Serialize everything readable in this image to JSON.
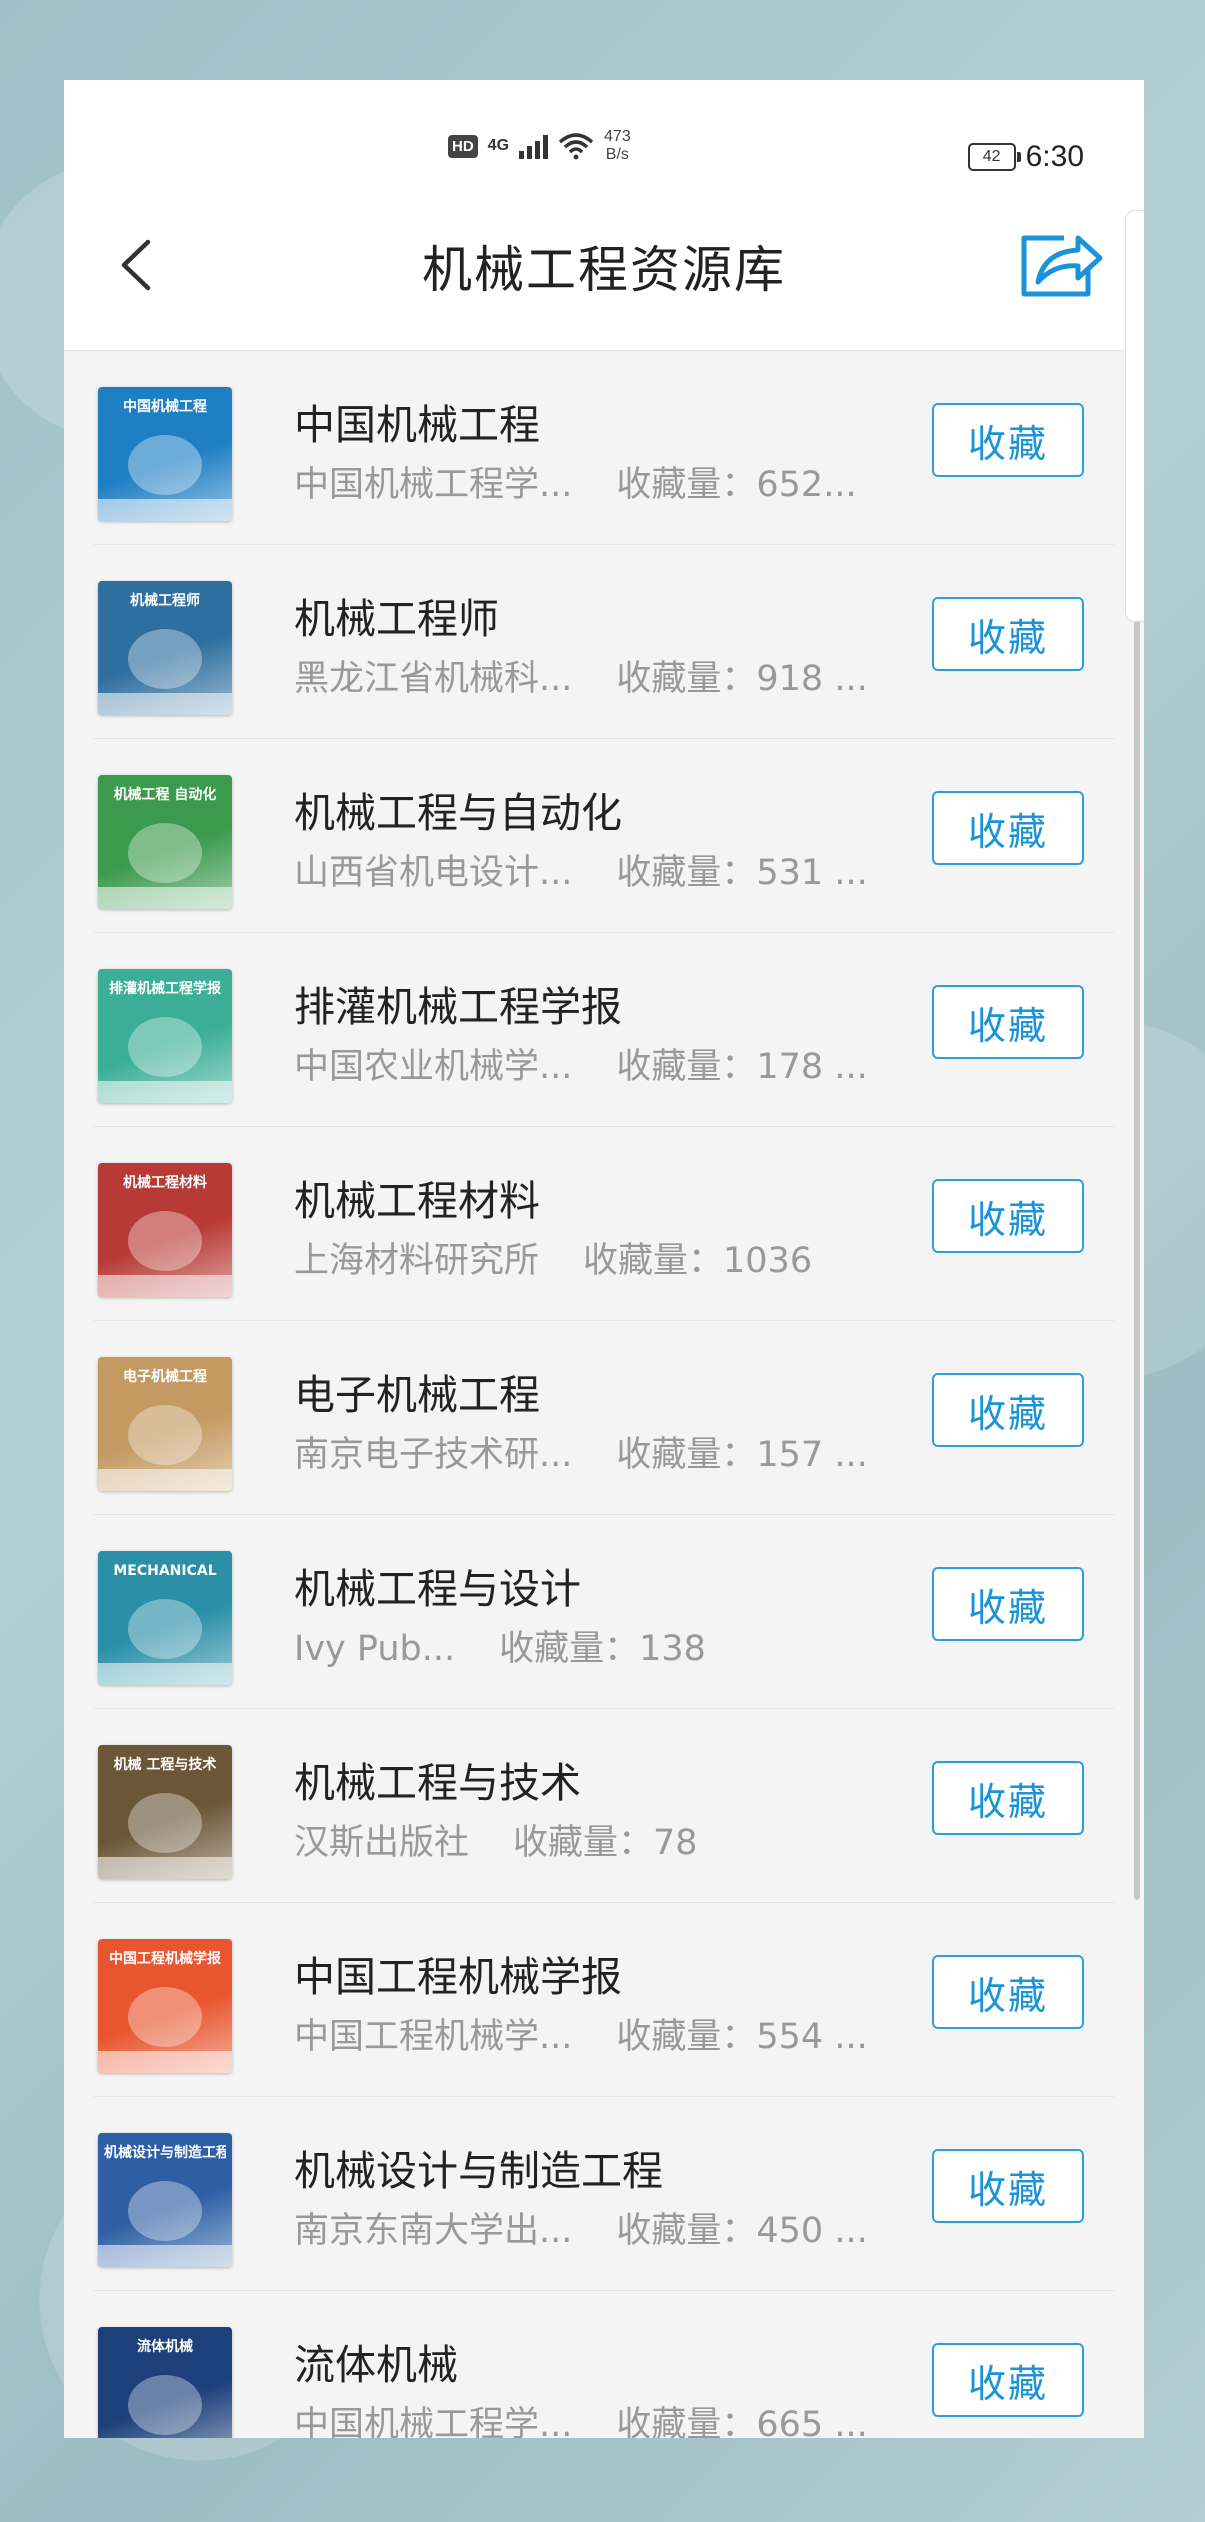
{
  "status_bar": {
    "hd": "HD",
    "network": "4G",
    "speed_value": "473",
    "speed_unit": "B/s",
    "battery": "42",
    "time": "6:30"
  },
  "navbar": {
    "title": "机械工程资源库"
  },
  "list": {
    "items": [
      {
        "title": "中国机械工程",
        "publisher": "中国机械工程学...",
        "count_label": "收藏量：652...",
        "button": "收藏",
        "cover_text": "中国机械工程",
        "cover_color": "#1f7fc4"
      },
      {
        "title": "机械工程师",
        "publisher": "黑龙江省机械科...",
        "count_label": "收藏量：918 ...",
        "button": "收藏",
        "cover_text": "机械工程师",
        "cover_color": "#2f6f9f"
      },
      {
        "title": "机械工程与自动化",
        "publisher": "山西省机电设计...",
        "count_label": "收藏量：531 ...",
        "button": "收藏",
        "cover_text": "机械工程 自动化",
        "cover_color": "#3c9a4e"
      },
      {
        "title": "排灌机械工程学报",
        "publisher": "中国农业机械学...",
        "count_label": "收藏量：178 ...",
        "button": "收藏",
        "cover_text": "排灌机械工程学报",
        "cover_color": "#3aae96"
      },
      {
        "title": "机械工程材料",
        "publisher": "上海材料研究所",
        "count_label": "收藏量：1036",
        "button": "收藏",
        "cover_text": "机械工程材料",
        "cover_color": "#b83a36"
      },
      {
        "title": "电子机械工程",
        "publisher": "南京电子技术研...",
        "count_label": "收藏量：157 ...",
        "button": "收藏",
        "cover_text": "电子机械工程",
        "cover_color": "#c49a62"
      },
      {
        "title": "机械工程与设计",
        "publisher": "Ivy Pub...",
        "count_label": "收藏量：138",
        "button": "收藏",
        "cover_text": "MECHANICAL",
        "cover_color": "#2b8fa8"
      },
      {
        "title": "机械工程与技术",
        "publisher": "汉斯出版社",
        "count_label": "收藏量：78",
        "button": "收藏",
        "cover_text": "机械 工程与技术",
        "cover_color": "#6b5638"
      },
      {
        "title": "中国工程机械学报",
        "publisher": "中国工程机械学...",
        "count_label": "收藏量：554 ...",
        "button": "收藏",
        "cover_text": "中国工程机械学报",
        "cover_color": "#e8552e"
      },
      {
        "title": "机械设计与制造工程",
        "publisher": "南京东南大学出...",
        "count_label": "收藏量：450 ...",
        "button": "收藏",
        "cover_text": "机械设计与制造工程",
        "cover_color": "#2e5fa4"
      },
      {
        "title": "流体机械",
        "publisher": "中国机械工程学...",
        "count_label": "收藏量：665 ...",
        "button": "收藏",
        "cover_text": "流体机械",
        "cover_color": "#1d3f7a"
      }
    ]
  },
  "colors": {
    "accent": "#1b93d8",
    "title_text": "#222222",
    "sub_text": "#999999"
  }
}
